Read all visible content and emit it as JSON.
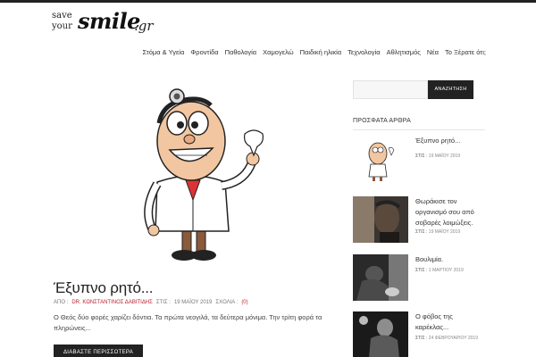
{
  "logo": {
    "line1": "save",
    "line2": "your",
    "big": "smile",
    "tld": ".gr"
  },
  "nav": [
    "Στόμα & Υγεία",
    "Φροντίδα",
    "Παθολογία",
    "Χαμογελώ",
    "Παιδική ηλικία",
    "Τεχνολογία",
    "Αθλητισμός",
    "Νέα",
    "Το Ξέρατε ότι;"
  ],
  "post": {
    "title": "Έξυπνο ρητό...",
    "meta_author_label": "ΑΠΟ :",
    "author": "DR. ΚΩΝΣΤΑΝΤΙΝΟΣ ΔΑΒΙΤΙΔΗΣ",
    "meta_date_label": "ΣΤΙΣ :",
    "date": "19 ΜΑΪΟΥ 2019",
    "meta_comments_label": "ΣΧΟΛΙΑ :",
    "comments": "(0)",
    "excerpt": "Ο Θεός δύο φορές χαρίζει δόντια. Τα πρώτα νεογιλά, τα δεύτερα μόνιμα. Την τρίτη φορά τα πληρώνεις...",
    "readmore": "ΔΙΑΒΑΣΤΕ ΠΕΡΙΣΣΟΤΕΡΑ"
  },
  "search": {
    "placeholder": "",
    "button": "ΑΝΑΖΗΤΗΣΗ"
  },
  "sidebar": {
    "heading": "ΠΡΟΣΦΑΤΑ ΑΡΘΡΑ",
    "items": [
      {
        "title": "Έξυπνο ρητό...",
        "date_label": "ΣΤΙΣ :",
        "date": "19 ΜΑΪΟΥ 2019"
      },
      {
        "title": "Θωράκισε τον οργανισμό σου από σοβαρές λοιμώξεις.",
        "date_label": "ΣΤΙΣ :",
        "date": "19 ΜΑΪΟΥ 2019"
      },
      {
        "title": "Βουλιμία.",
        "date_label": "ΣΤΙΣ :",
        "date": "1 ΜΑΡΤΙΟΥ 2019"
      },
      {
        "title": "Ο φόβος της καρέκλας...",
        "date_label": "ΣΤΙΣ :",
        "date": "24 ΦΕΒΡΟΥΑΡΙΟΥ 2019"
      }
    ]
  },
  "colors": {
    "accent": "#222222",
    "meta_highlight": "#bb2233"
  }
}
